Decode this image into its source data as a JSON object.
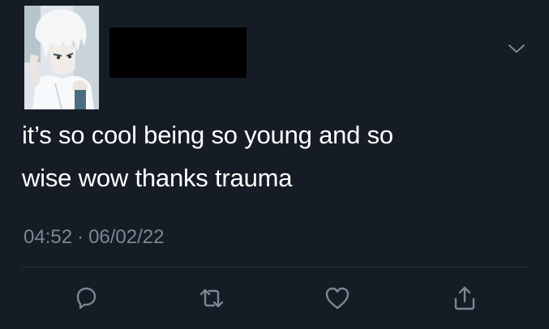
{
  "tweet": {
    "text": "it’s so cool being so young and so\nwise wow thanks trauma",
    "time": "04:52",
    "separator": "·",
    "date": "06/02/22"
  },
  "icons": {
    "menu": "chevron-down-icon",
    "reply": "reply-icon",
    "retweet": "retweet-icon",
    "like": "heart-icon",
    "share": "share-icon"
  },
  "colors": {
    "background": "#151c26",
    "text": "#ffffff",
    "muted": "#7d8791",
    "divider": "#2c3541",
    "redaction": "#000000"
  }
}
